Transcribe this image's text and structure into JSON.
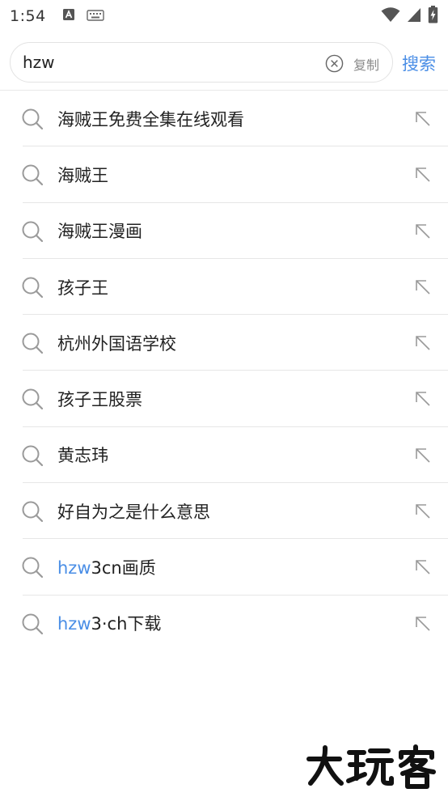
{
  "status_bar": {
    "time": "1:54"
  },
  "search": {
    "query": "hzw",
    "copy_label": "复制",
    "search_label": "搜索"
  },
  "suggestions": [
    {
      "highlight": "",
      "text": "海贼王免费全集在线观看"
    },
    {
      "highlight": "",
      "text": "海贼王"
    },
    {
      "highlight": "",
      "text": "海贼王漫画"
    },
    {
      "highlight": "",
      "text": "孩子王"
    },
    {
      "highlight": "",
      "text": "杭州外国语学校"
    },
    {
      "highlight": "",
      "text": "孩子王股票"
    },
    {
      "highlight": "",
      "text": "黄志玮"
    },
    {
      "highlight": "",
      "text": "好自为之是什么意思"
    },
    {
      "highlight": "hzw",
      "text": "3cn画质"
    },
    {
      "highlight": "hzw",
      "text": "3·ch下载"
    }
  ],
  "watermark": {
    "text": "大玩客"
  },
  "colors": {
    "accent": "#4a8ee6",
    "divider": "#e6e6e6",
    "icon_gray": "#9a9a9a"
  }
}
